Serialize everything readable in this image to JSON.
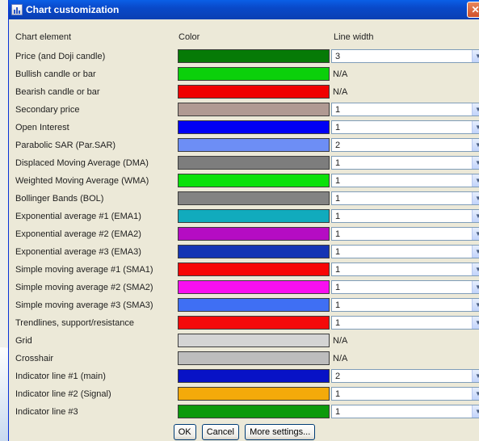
{
  "window": {
    "title": "Chart customization"
  },
  "headers": {
    "element": "Chart element",
    "color": "Color",
    "line_width": "Line width"
  },
  "rows": [
    {
      "label": "Price (and Doji candle)",
      "color": "#067a06",
      "width": "3"
    },
    {
      "label": "Bullish candle or bar",
      "color": "#0bd00b",
      "width": "N/A"
    },
    {
      "label": "Bearish candle or bar",
      "color": "#f00000",
      "width": "N/A"
    },
    {
      "label": "Secondary price",
      "color": "#b09a93",
      "width": "1"
    },
    {
      "label": "Open Interest",
      "color": "#0000f4",
      "width": "1"
    },
    {
      "label": "Parabolic SAR (Par.SAR)",
      "color": "#6d8ef5",
      "width": "2"
    },
    {
      "label": "Displaced Moving Average (DMA)",
      "color": "#7d7d7d",
      "width": "1"
    },
    {
      "label": "Weighted Moving Average (WMA)",
      "color": "#0ae10a",
      "width": "1"
    },
    {
      "label": "Bollinger Bands (BOL)",
      "color": "#838383",
      "width": "1"
    },
    {
      "label": "Exponential average #1 (EMA1)",
      "color": "#11abbd",
      "width": "1"
    },
    {
      "label": "Exponential average #2 (EMA2)",
      "color": "#b50cc3",
      "width": "1"
    },
    {
      "label": "Exponential average #3 (EMA3)",
      "color": "#1535b4",
      "width": "1"
    },
    {
      "label": "Simple moving average #1 (SMA1)",
      "color": "#f70606",
      "width": "1"
    },
    {
      "label": "Simple moving average #2 (SMA2)",
      "color": "#f80ff0",
      "width": "1"
    },
    {
      "label": "Simple moving average #3 (SMA3)",
      "color": "#3f6ff4",
      "width": "1"
    },
    {
      "label": "Trendlines, support/resistance",
      "color": "#f40a0a",
      "width": "1"
    },
    {
      "label": "Grid",
      "color": "#d4d4d4",
      "width": "N/A"
    },
    {
      "label": "Crosshair",
      "color": "#bdbdbd",
      "width": "N/A"
    },
    {
      "label": "Indicator line #1 (main)",
      "color": "#0812c6",
      "width": "2"
    },
    {
      "label": "Indicator line #2 (Signal)",
      "color": "#f4aa0a",
      "width": "1"
    },
    {
      "label": "Indicator line #3",
      "color": "#0c9a0c",
      "width": "1"
    }
  ],
  "buttons": {
    "ok": "OK",
    "cancel": "Cancel",
    "more": "More settings..."
  },
  "icons": {
    "close": "close-icon",
    "app": "chart-icon",
    "dropdown": "chevron-down-icon"
  }
}
